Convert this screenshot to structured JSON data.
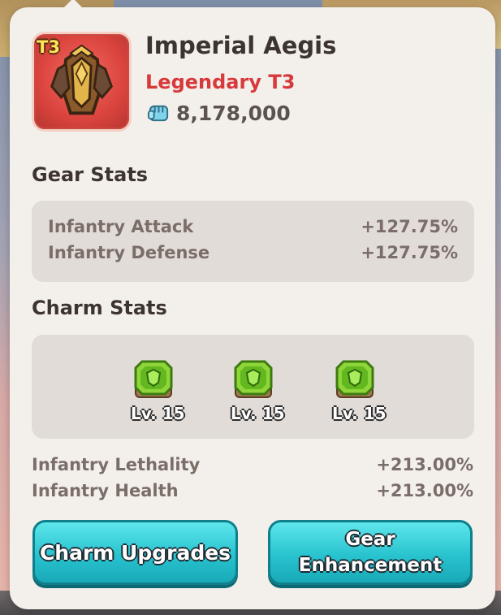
{
  "item": {
    "name": "Imperial Aegis",
    "rarity": "Legendary T3",
    "tier_badge": "T3",
    "power": "8,178,000",
    "icon": "armor-icon",
    "power_icon": "fist-power-icon"
  },
  "gear_stats": {
    "title": "Gear Stats",
    "rows": [
      {
        "label": "Infantry Attack",
        "value": "+127.75%"
      },
      {
        "label": "Infantry Defense",
        "value": "+127.75%"
      }
    ]
  },
  "charm_stats": {
    "title": "Charm Stats",
    "charms": [
      {
        "icon": "green-charm-icon",
        "level": "Lv. 15"
      },
      {
        "icon": "green-charm-icon",
        "level": "Lv. 15"
      },
      {
        "icon": "green-charm-icon",
        "level": "Lv. 15"
      }
    ],
    "rows": [
      {
        "label": "Infantry Lethality",
        "value": "+213.00%"
      },
      {
        "label": "Infantry Health",
        "value": "+213.00%"
      }
    ]
  },
  "buttons": {
    "charm_upgrades": "Charm Upgrades",
    "gear_enhancement_line1": "Gear",
    "gear_enhancement_line2": "Enhancement"
  },
  "colors": {
    "rarity": "#d8393b",
    "button": "#28c3cf",
    "panel": "#f3f0ec",
    "item_background": "#db443e"
  }
}
